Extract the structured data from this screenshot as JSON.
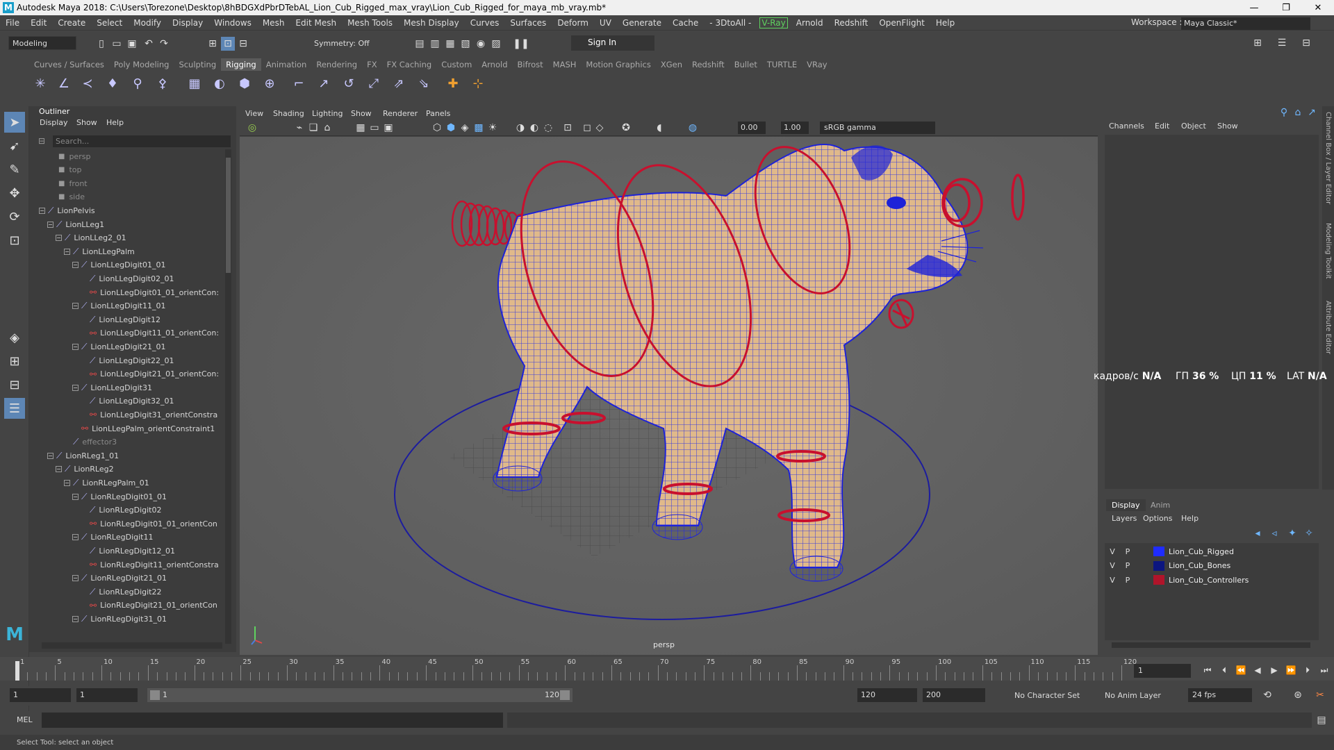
{
  "window": {
    "title": "Autodesk Maya 2018: C:\\Users\\Torezone\\Desktop\\8hBDGXdPbrDTebAL_Lion_Cub_Rigged_max_vray\\Lion_Cub_Rigged_for_maya_mb_vray.mb*",
    "logo": "M",
    "controls": [
      "—",
      "❐",
      "✕"
    ]
  },
  "menubar": {
    "items": [
      "File",
      "Edit",
      "Create",
      "Select",
      "Modify",
      "Display",
      "Windows",
      "Mesh",
      "Edit Mesh",
      "Mesh Tools",
      "Mesh Display",
      "Curves",
      "Surfaces",
      "Deform",
      "UV",
      "Generate",
      "Cache",
      "- 3DtoAll -"
    ],
    "vray_label": "V-Ray",
    "items_after": [
      "Arnold",
      "Redshift",
      "OpenFlight",
      "Help"
    ],
    "workspace_label": "Workspace :",
    "workspace_value": "Maya Classic*"
  },
  "statusline": {
    "mode": "Modeling",
    "symmetry": "Symmetry: Off",
    "sign_in": "Sign In"
  },
  "shelf": {
    "tabs": [
      "Curves / Surfaces",
      "Poly Modeling",
      "Sculpting",
      "Rigging",
      "Animation",
      "Rendering",
      "FX",
      "FX Caching",
      "Custom",
      "Arnold",
      "Bifrost",
      "MASH",
      "Motion Graphics",
      "XGen",
      "Redshift",
      "Bullet",
      "TURTLE",
      "VRay"
    ],
    "active_tab": "Rigging"
  },
  "outliner": {
    "title": "Outliner",
    "menu": [
      "Display",
      "Show",
      "Help"
    ],
    "search_placeholder": "Search...",
    "nodes": [
      {
        "label": "persp",
        "depth": 0,
        "type": "camera",
        "dim": true
      },
      {
        "label": "top",
        "depth": 0,
        "type": "camera",
        "dim": true
      },
      {
        "label": "front",
        "depth": 0,
        "type": "camera",
        "dim": true
      },
      {
        "label": "side",
        "depth": 0,
        "type": "camera",
        "dim": true
      },
      {
        "label": "LionPelvis",
        "depth": 0,
        "type": "joint",
        "exp": true
      },
      {
        "label": "LionLLeg1",
        "depth": 1,
        "type": "joint",
        "exp": true
      },
      {
        "label": "LionLLeg2_01",
        "depth": 2,
        "type": "joint",
        "exp": true
      },
      {
        "label": "LionLLegPalm",
        "depth": 3,
        "type": "joint",
        "exp": true
      },
      {
        "label": "LionLLegDigit01_01",
        "depth": 4,
        "type": "joint",
        "exp": true
      },
      {
        "label": "LionLLegDigit02_01",
        "depth": 5,
        "type": "joint"
      },
      {
        "label": "LionLLegDigit01_01_orientCon:",
        "depth": 5,
        "type": "constraint"
      },
      {
        "label": "LionLLegDigit11_01",
        "depth": 4,
        "type": "joint",
        "exp": true
      },
      {
        "label": "LionLLegDigit12",
        "depth": 5,
        "type": "joint"
      },
      {
        "label": "LionLLegDigit11_01_orientCon:",
        "depth": 5,
        "type": "constraint"
      },
      {
        "label": "LionLLegDigit21_01",
        "depth": 4,
        "type": "joint",
        "exp": true
      },
      {
        "label": "LionLLegDigit22_01",
        "depth": 5,
        "type": "joint"
      },
      {
        "label": "LionLLegDigit21_01_orientCon:",
        "depth": 5,
        "type": "constraint"
      },
      {
        "label": "LionLLegDigit31",
        "depth": 4,
        "type": "joint",
        "exp": true
      },
      {
        "label": "LionLLegDigit32_01",
        "depth": 5,
        "type": "joint"
      },
      {
        "label": "LionLLegDigit31_orientConstra",
        "depth": 5,
        "type": "constraint"
      },
      {
        "label": "LionLLegPalm_orientConstraint1",
        "depth": 4,
        "type": "constraint"
      },
      {
        "label": "effector3",
        "depth": 3,
        "type": "joint",
        "dim": true
      },
      {
        "label": "LionRLeg1_01",
        "depth": 1,
        "type": "joint",
        "exp": true
      },
      {
        "label": "LionRLeg2",
        "depth": 2,
        "type": "joint",
        "exp": true
      },
      {
        "label": "LionRLegPalm_01",
        "depth": 3,
        "type": "joint",
        "exp": true
      },
      {
        "label": "LionRLegDigit01_01",
        "depth": 4,
        "type": "joint",
        "exp": true
      },
      {
        "label": "LionRLegDigit02",
        "depth": 5,
        "type": "joint"
      },
      {
        "label": "LionRLegDigit01_01_orientCon",
        "depth": 5,
        "type": "constraint"
      },
      {
        "label": "LionRLegDigit11",
        "depth": 4,
        "type": "joint",
        "exp": true
      },
      {
        "label": "LionRLegDigit12_01",
        "depth": 5,
        "type": "joint"
      },
      {
        "label": "LionRLegDigit11_orientConstra",
        "depth": 5,
        "type": "constraint"
      },
      {
        "label": "LionRLegDigit21_01",
        "depth": 4,
        "type": "joint",
        "exp": true
      },
      {
        "label": "LionRLegDigit22",
        "depth": 5,
        "type": "joint"
      },
      {
        "label": "LionRLegDigit21_01_orientCon",
        "depth": 5,
        "type": "constraint"
      },
      {
        "label": "LionRLegDigit31_01",
        "depth": 4,
        "type": "joint",
        "exp": true
      }
    ]
  },
  "viewport": {
    "menu": [
      "View",
      "Shading",
      "Lighting",
      "Show",
      "Renderer",
      "Panels"
    ],
    "exposure": "0.00",
    "gamma": "1.00",
    "color_space": "sRGB gamma",
    "camera_label": "persp"
  },
  "channelbox": {
    "menu": [
      "Channels",
      "Edit",
      "Object",
      "Show"
    ],
    "side_tabs": [
      "Channel Box / Layer Editor",
      "Modeling Toolkit",
      "Attribute Editor"
    ]
  },
  "hud": {
    "fps_label": "кадров/с",
    "fps_value": "N/A",
    "gpu_label": "ГП",
    "gpu_value": "36 %",
    "cpu_label": "ЦП",
    "cpu_value": "11 %",
    "lat_label": "LAT",
    "lat_value": "N/A"
  },
  "layers": {
    "tabs": [
      "Display",
      "Anim"
    ],
    "active_tab": "Display",
    "menu": [
      "Layers",
      "Options",
      "Help"
    ],
    "rows": [
      {
        "v": "V",
        "p": "P",
        "name": "Lion_Cub_Rigged",
        "color": "#1f2cff"
      },
      {
        "v": "V",
        "p": "P",
        "name": "Lion_Cub_Bones",
        "color": "#0c1680"
      },
      {
        "v": "V",
        "p": "P",
        "name": "Lion_Cub_Controllers",
        "color": "#b0142a"
      }
    ]
  },
  "timeline": {
    "ticks": [
      "1",
      "5",
      "10",
      "15",
      "20",
      "25",
      "30",
      "35",
      "40",
      "45",
      "50",
      "55",
      "60",
      "65",
      "70",
      "75",
      "80",
      "85",
      "90",
      "95",
      "100",
      "105",
      "110",
      "115",
      "120"
    ],
    "current_frame": "1"
  },
  "range": {
    "start": "1",
    "anim_start": "1",
    "slider_start": "1",
    "slider_end": "120",
    "end": "120",
    "anim_end": "200",
    "character_set": "No Character Set",
    "anim_layer": "No Anim Layer",
    "fps": "24 fps"
  },
  "commandline": {
    "label": "MEL"
  },
  "helpline": {
    "text": "Select Tool: select an object"
  }
}
